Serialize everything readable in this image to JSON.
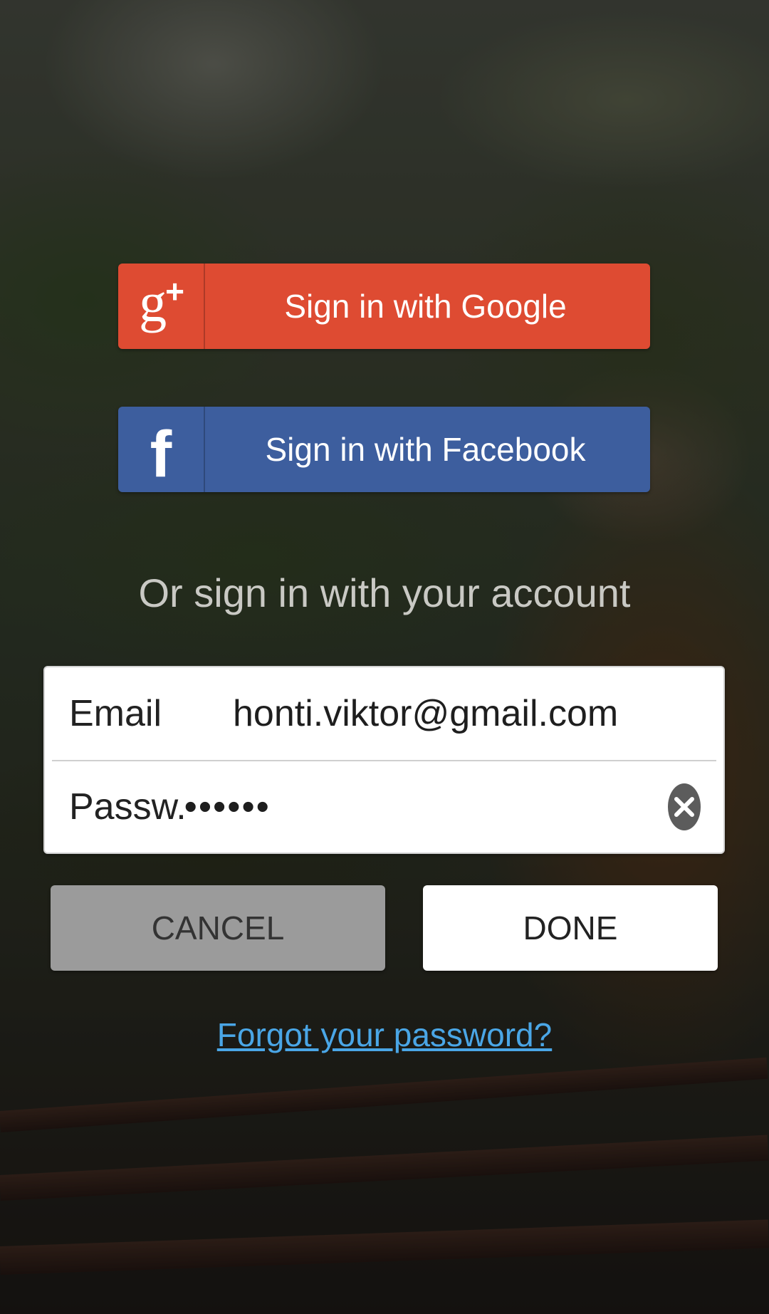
{
  "social": {
    "google_label": "Sign in with Google",
    "google_icon": "google-plus-icon",
    "google_color": "#de4b32",
    "facebook_label": "Sign in with Facebook",
    "facebook_icon": "facebook-icon",
    "facebook_color": "#3d5e9e"
  },
  "divider_text": "Or sign in with your account",
  "form": {
    "email_label": "Email",
    "email_value": "honti.viktor@gmail.com",
    "password_label": "Passw...",
    "password_value": "••••••",
    "clear_icon": "clear-circle-icon"
  },
  "actions": {
    "cancel_label": "CANCEL",
    "done_label": "DONE"
  },
  "forgot_password_label": "Forgot your password?",
  "colors": {
    "link": "#4aa6e6",
    "cancel_bg": "#9b9b9b",
    "done_bg": "#ffffff"
  }
}
